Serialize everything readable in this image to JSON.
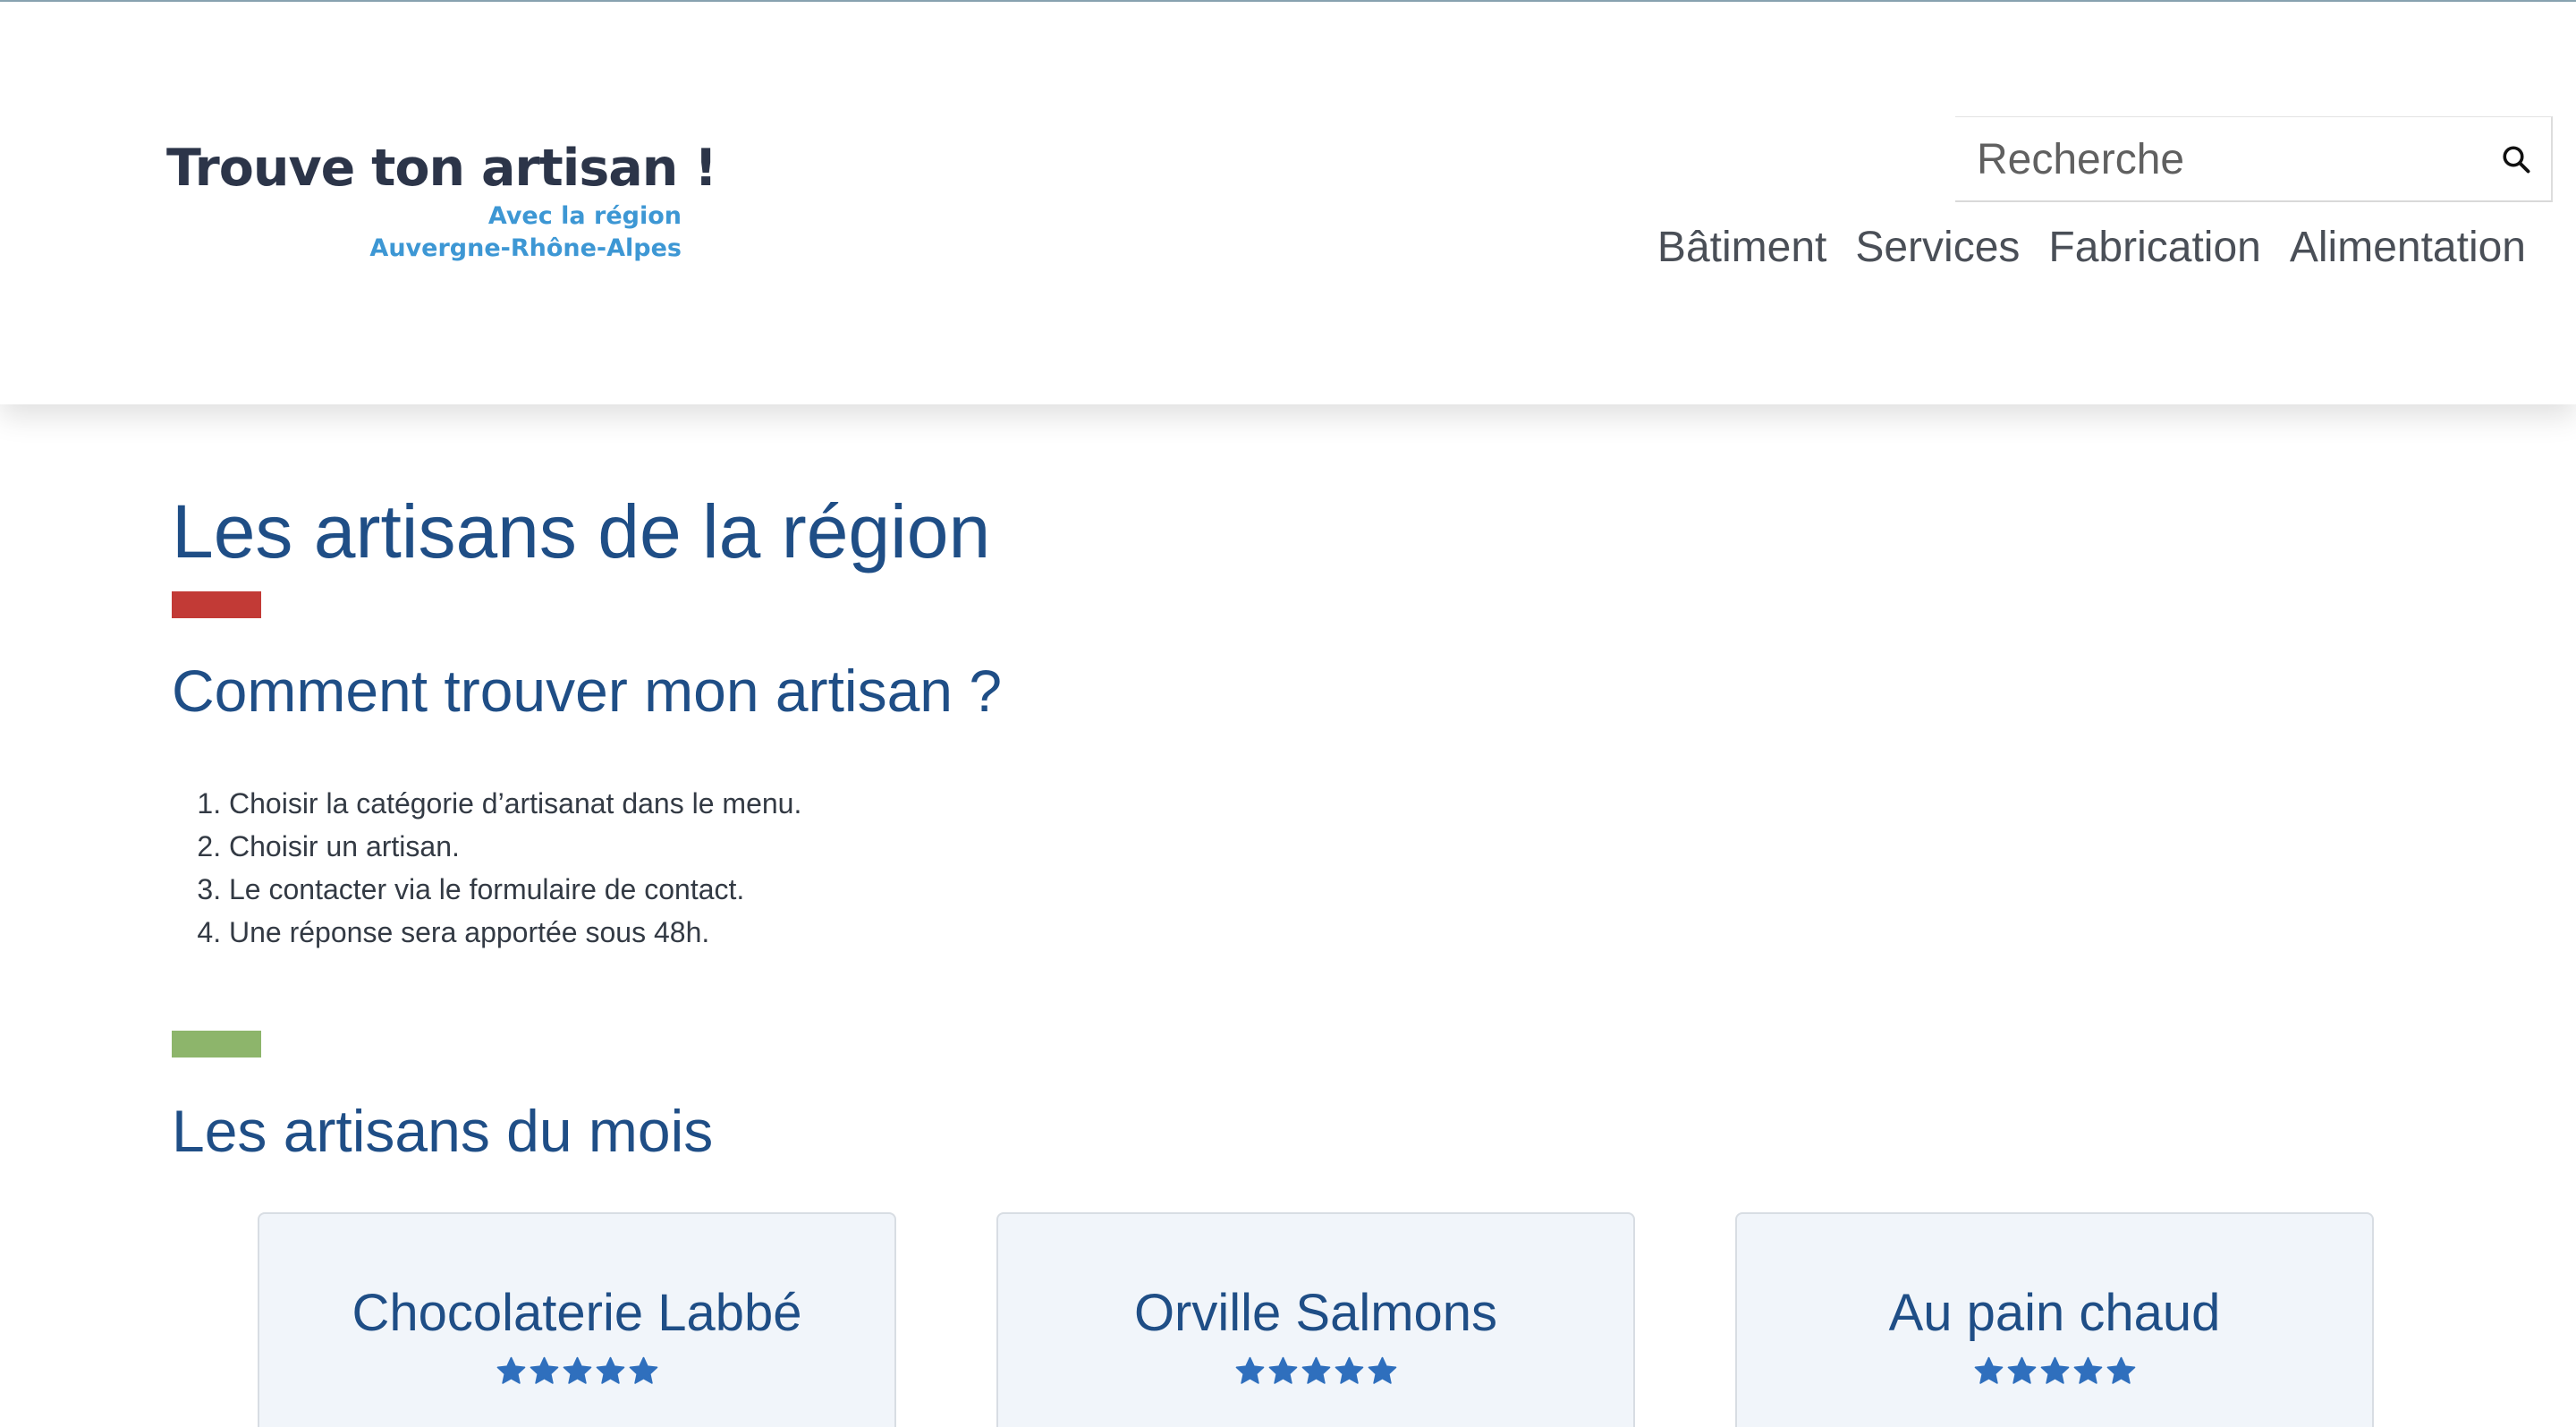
{
  "header": {
    "logo_title": "Trouve ton artisan !",
    "logo_subtitle_line1": "Avec la région",
    "logo_subtitle_line2": "Auvergne-Rhône-Alpes",
    "search": {
      "placeholder": "Recherche",
      "value": "",
      "icon": "search-icon"
    },
    "nav": [
      "Bâtiment",
      "Services",
      "Fabrication",
      "Alimentation"
    ]
  },
  "main": {
    "title": "Les artisans de la région",
    "how_title": "Comment trouver mon artisan ?",
    "steps": [
      "Choisir la catégorie d’artisanat dans le menu.",
      "Choisir un artisan.",
      "Le contacter via le formulaire de contact.",
      "Une réponse sera apportée sous 48h."
    ],
    "month_title": "Les artisans du mois",
    "artisans": [
      {
        "name": "Chocolaterie Labbé",
        "rating": 5,
        "max_rating": 5
      },
      {
        "name": "Orville Salmons",
        "rating": 5,
        "max_rating": 5
      },
      {
        "name": "Au pain chaud",
        "rating": 5,
        "max_rating": 5
      }
    ]
  },
  "colors": {
    "primary": "#1f4e86",
    "logo_text": "#2c3549",
    "logo_accent": "#3d97d4",
    "accent_red": "#c23a36",
    "accent_green": "#8db56b",
    "star": "#2f6fbd",
    "card_bg": "#f1f5fa"
  }
}
